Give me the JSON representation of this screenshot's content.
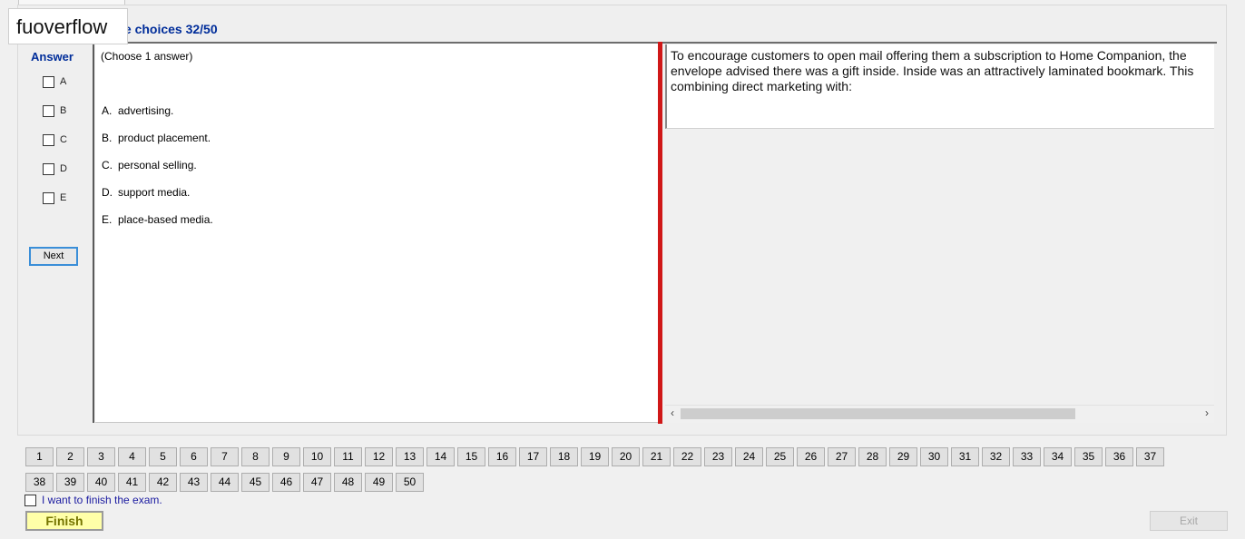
{
  "watermark": "fuoverflow",
  "heading": "le choices 32/50",
  "answer": {
    "title": "Answer",
    "options": [
      "A",
      "B",
      "C",
      "D",
      "E"
    ],
    "next_label": "Next"
  },
  "question": {
    "instruction": "(Choose 1 answer)",
    "choices": [
      {
        "letter": "A.",
        "text": "advertising."
      },
      {
        "letter": "B.",
        "text": "product placement."
      },
      {
        "letter": "C.",
        "text": "personal selling."
      },
      {
        "letter": "D.",
        "text": "support media."
      },
      {
        "letter": "E.",
        "text": "place-based media."
      }
    ]
  },
  "stem": {
    "text": "To encourage customers to open mail offering them a subscription to Home Companion, the envelope advised there was a gift inside. Inside was an attractively laminated bookmark. This combining direct marketing with:"
  },
  "scrollbar": {
    "left_arrow": "‹",
    "right_arrow": "›"
  },
  "question_nav": {
    "row1": [
      "1",
      "2",
      "3",
      "4",
      "5",
      "6",
      "7",
      "8",
      "9",
      "10",
      "11",
      "12",
      "13",
      "14",
      "15",
      "16",
      "17",
      "18",
      "19",
      "20",
      "21",
      "22",
      "23",
      "24",
      "25",
      "26",
      "27",
      "28",
      "29",
      "30",
      "31",
      "32",
      "33",
      "34",
      "35",
      "36",
      "37"
    ],
    "row2": [
      "38",
      "39",
      "40",
      "41",
      "42",
      "43",
      "44",
      "45",
      "46",
      "47",
      "48",
      "49",
      "50"
    ]
  },
  "finish": {
    "checkbox_label": "I want to finish the exam.",
    "finish_label": "Finish",
    "exit_label": "Exit"
  },
  "colors": {
    "accent_blue": "#002d9a",
    "divider_red": "#d01818",
    "finish_yellow": "#ffffa8"
  }
}
